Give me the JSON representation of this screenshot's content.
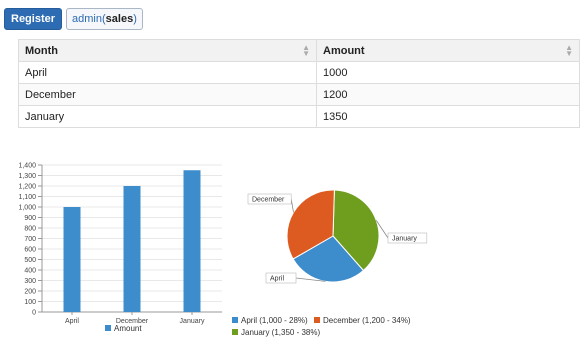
{
  "toolbar": {
    "register_label": "Register",
    "user_prefix": "admin(",
    "user_role": "sales",
    "user_suffix": ")"
  },
  "table": {
    "columns": [
      "Month",
      "Amount"
    ],
    "rows": [
      [
        "April",
        "1000"
      ],
      [
        "December",
        "1200"
      ],
      [
        "January",
        "1350"
      ]
    ]
  },
  "colors": {
    "bar": "#3d8ccc",
    "april": "#3d8ccc",
    "december": "#dd5a20",
    "january": "#6f9e1e"
  },
  "chart_data": [
    {
      "type": "bar",
      "categories": [
        "April",
        "December",
        "January"
      ],
      "values": [
        1000,
        1200,
        1350
      ],
      "ylim": [
        0,
        1400
      ],
      "yticks": [
        "0",
        "100",
        "200",
        "300",
        "400",
        "500",
        "600",
        "700",
        "800",
        "900",
        "1,000",
        "1,100",
        "1,200",
        "1,300",
        "1,400"
      ],
      "legend": [
        "Amount"
      ],
      "grid": true
    },
    {
      "type": "pie",
      "labels": [
        "April",
        "December",
        "January"
      ],
      "values": [
        1000,
        1200,
        1350
      ],
      "legend": [
        "April (1,000 - 28%)",
        "December (1,200 - 34%)",
        "January (1,350 - 38%)"
      ]
    }
  ]
}
